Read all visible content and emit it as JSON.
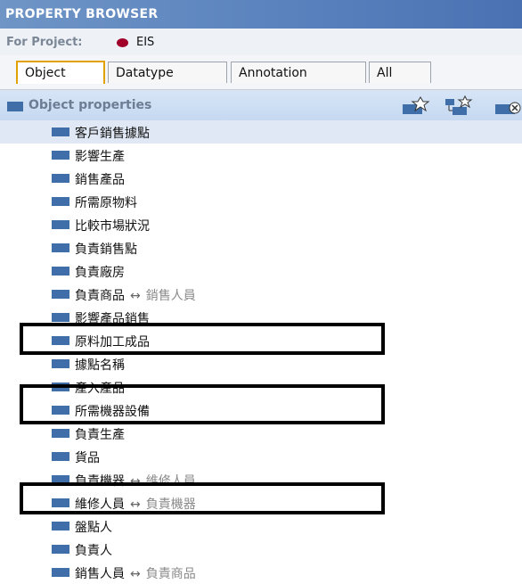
{
  "header": {
    "title": "PROPERTY BROWSER"
  },
  "project": {
    "label": "For Project:",
    "name": "EIS",
    "dot_color": "#a0002a"
  },
  "tabs": [
    {
      "label": "Object",
      "active": true
    },
    {
      "label": "Datatype",
      "active": false
    },
    {
      "label": "Annotation",
      "active": false
    },
    {
      "label": "All",
      "active": false
    }
  ],
  "section": {
    "label": "Object properties"
  },
  "toolbar_icons": [
    "add-property-icon",
    "add-subproperty-icon",
    "delete-property-icon"
  ],
  "items": [
    {
      "text": "客戶銷售據點",
      "selected": true
    },
    {
      "text": "影響生產"
    },
    {
      "text": "銷售產品"
    },
    {
      "text": "所需原物料"
    },
    {
      "text": "比較市場狀況"
    },
    {
      "text": "負責銷售點"
    },
    {
      "text": "負責廠房"
    },
    {
      "text": "負責商品",
      "arrow": "↔",
      "inverse": "銷售人員"
    },
    {
      "text": "影響產品銷售"
    },
    {
      "text": "原料加工成品"
    },
    {
      "text": "據點名稱"
    },
    {
      "text": "產入產品"
    },
    {
      "text": "所需機器設備"
    },
    {
      "text": "負責生產"
    },
    {
      "text": "貨品"
    },
    {
      "text": "負責機器",
      "arrow": "↔",
      "inverse": "維修人員"
    },
    {
      "text": "維修人員",
      "arrow": "↔",
      "inverse": "負責機器"
    },
    {
      "text": "盤點人"
    },
    {
      "text": "負責人"
    },
    {
      "text": "銷售人員",
      "arrow": "↔",
      "inverse": "負責商品"
    }
  ]
}
